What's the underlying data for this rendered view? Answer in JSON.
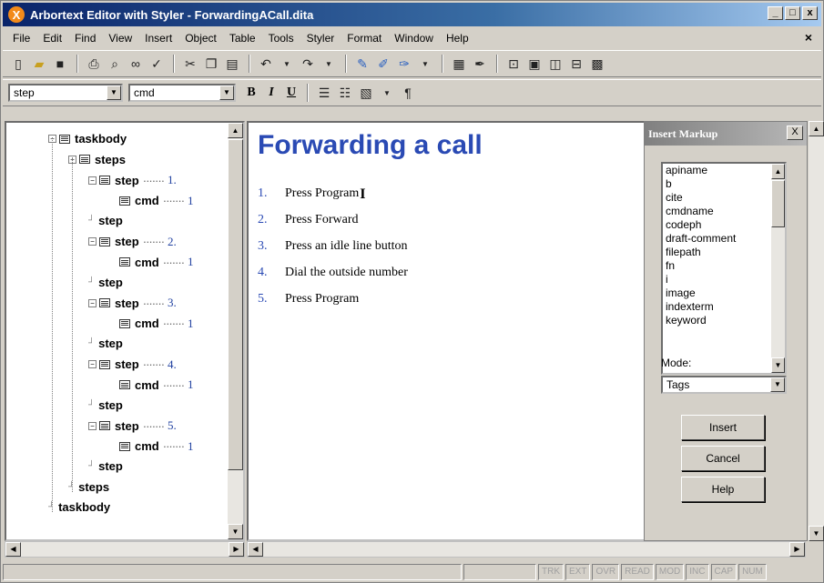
{
  "window": {
    "title": "Arbortext Editor with Styler - ForwardingACall.dita",
    "app_icon_glyph": "X",
    "controls": [
      "_",
      "□",
      "x"
    ]
  },
  "menubar": {
    "items": [
      "File",
      "Edit",
      "Find",
      "View",
      "Insert",
      "Object",
      "Table",
      "Tools",
      "Styler",
      "Format",
      "Window",
      "Help"
    ],
    "close_glyph": "×"
  },
  "toolbar2": {
    "element_combo": "step",
    "tag_combo": "cmd",
    "bold": "B",
    "italic": "I",
    "underline": "U"
  },
  "tree": {
    "nodes": [
      {
        "label": "taskbody",
        "num": "",
        "depth": 0,
        "type": "open"
      },
      {
        "label": "steps",
        "num": "",
        "depth": 1,
        "type": "open"
      },
      {
        "label": "step",
        "num": "1.",
        "depth": 2,
        "type": "open"
      },
      {
        "label": "cmd",
        "num": "1",
        "depth": 3,
        "type": "leaf"
      },
      {
        "label": "step",
        "num": "",
        "depth": 2,
        "type": "end"
      },
      {
        "label": "step",
        "num": "2.",
        "depth": 2,
        "type": "open"
      },
      {
        "label": "cmd",
        "num": "1",
        "depth": 3,
        "type": "leaf"
      },
      {
        "label": "step",
        "num": "",
        "depth": 2,
        "type": "end"
      },
      {
        "label": "step",
        "num": "3.",
        "depth": 2,
        "type": "open"
      },
      {
        "label": "cmd",
        "num": "1",
        "depth": 3,
        "type": "leaf"
      },
      {
        "label": "step",
        "num": "",
        "depth": 2,
        "type": "end"
      },
      {
        "label": "step",
        "num": "4.",
        "depth": 2,
        "type": "open"
      },
      {
        "label": "cmd",
        "num": "1",
        "depth": 3,
        "type": "leaf"
      },
      {
        "label": "step",
        "num": "",
        "depth": 2,
        "type": "end"
      },
      {
        "label": "step",
        "num": "5.",
        "depth": 2,
        "type": "open"
      },
      {
        "label": "cmd",
        "num": "1",
        "depth": 3,
        "type": "leaf"
      },
      {
        "label": "step",
        "num": "",
        "depth": 2,
        "type": "end"
      },
      {
        "label": "steps",
        "num": "",
        "depth": 1,
        "type": "end"
      },
      {
        "label": "taskbody",
        "num": "",
        "depth": 0,
        "type": "end"
      }
    ]
  },
  "document": {
    "title": "Forwarding a call",
    "steps": [
      {
        "num": "1.",
        "text": "Press Program"
      },
      {
        "num": "2.",
        "text": "Press Forward"
      },
      {
        "num": "3.",
        "text": "Press an idle line button"
      },
      {
        "num": "4.",
        "text": "Dial the outside number"
      },
      {
        "num": "5.",
        "text": "Press Program"
      }
    ]
  },
  "insert_markup": {
    "title": "Insert Markup",
    "close_glyph": "X",
    "tags": [
      "apiname",
      "b",
      "cite",
      "cmdname",
      "codeph",
      "draft-comment",
      "filepath",
      "fn",
      "i",
      "image",
      "indexterm",
      "keyword"
    ],
    "mode_label": "Mode:",
    "mode_value": "Tags",
    "insert_label": "Insert",
    "cancel_label": "Cancel",
    "help_label": "Help"
  },
  "statusbar": {
    "indicators": [
      "TRK",
      "EXT",
      "OVR",
      "READ",
      "MOD",
      "INC",
      "CAP",
      "NUM"
    ]
  },
  "colors": {
    "heading": "#2a4ab4",
    "titlebar": "#0a246a",
    "app_icon": "#f28a1a"
  }
}
